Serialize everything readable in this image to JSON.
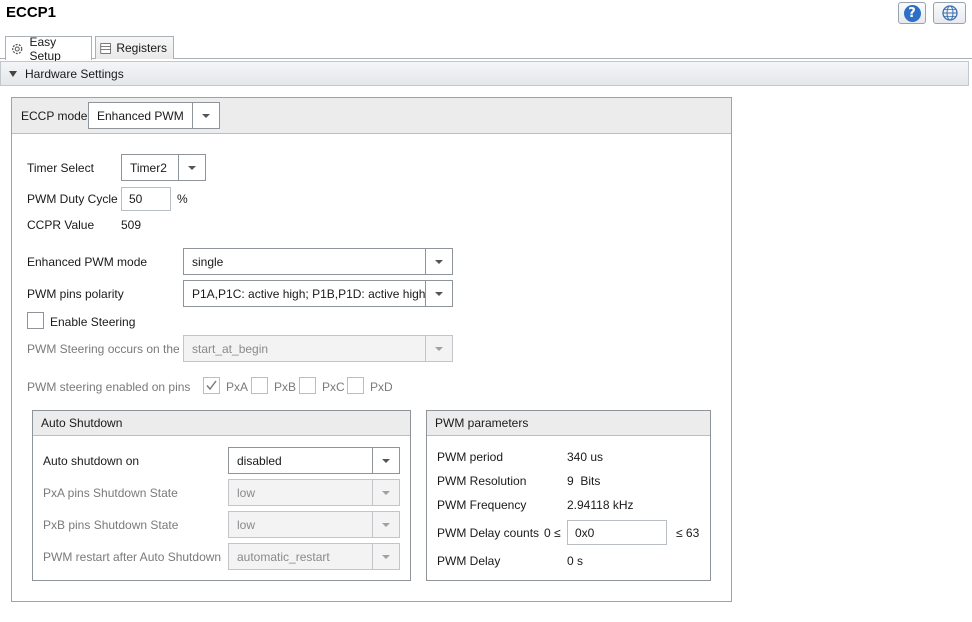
{
  "window": {
    "title": "ECCP1"
  },
  "header_buttons": {
    "help_icon": "help-icon",
    "globe_icon": "globe-icon"
  },
  "tabs": [
    {
      "label": "Easy Setup",
      "icon": "gear-icon",
      "active": true
    },
    {
      "label": "Registers",
      "icon": "list-icon",
      "active": false
    }
  ],
  "section": {
    "title": "Hardware Settings"
  },
  "eccp_mode": {
    "label": "ECCP mode",
    "value": "Enhanced PWM"
  },
  "timer_select": {
    "label": "Timer Select",
    "value": "Timer2"
  },
  "duty_cycle": {
    "label": "PWM Duty Cycle",
    "value": "50",
    "unit": "%"
  },
  "ccpr": {
    "label": "CCPR Value",
    "value": "509"
  },
  "enhanced_mode": {
    "label": "Enhanced PWM mode",
    "value": "single"
  },
  "pins_polarity": {
    "label": "PWM pins polarity",
    "value": "P1A,P1C: active high; P1B,P1D: active high"
  },
  "enable_steering": {
    "label": "Enable Steering",
    "checked": false
  },
  "steering_occurs": {
    "label": "PWM Steering occurs on the",
    "value": "start_at_begin"
  },
  "steering_pins": {
    "label": "PWM steering enabled on pins",
    "pins": [
      {
        "label": "PxA",
        "checked": true
      },
      {
        "label": "PxB",
        "checked": false
      },
      {
        "label": "PxC",
        "checked": false
      },
      {
        "label": "PxD",
        "checked": false
      }
    ]
  },
  "auto_shutdown": {
    "title": "Auto Shutdown",
    "on": {
      "label": "Auto shutdown on",
      "value": "disabled"
    },
    "pxa": {
      "label": "PxA pins Shutdown State",
      "value": "low"
    },
    "pxb": {
      "label": "PxB pins Shutdown State",
      "value": "low"
    },
    "restart": {
      "label": "PWM restart after Auto Shutdown",
      "value": "automatic_restart"
    }
  },
  "pwm_params": {
    "title": "PWM parameters",
    "period": {
      "label": "PWM period",
      "value": "340 us"
    },
    "resolution": {
      "label": "PWM Resolution",
      "value": "9  Bits"
    },
    "frequency": {
      "label": "PWM Frequency",
      "value": "2.94118 kHz"
    },
    "delay_counts": {
      "label": "PWM Delay counts",
      "min": "0 ≤",
      "value": "0x0",
      "max": "≤ 63"
    },
    "delay": {
      "label": "PWM Delay",
      "value": "0 s"
    }
  }
}
